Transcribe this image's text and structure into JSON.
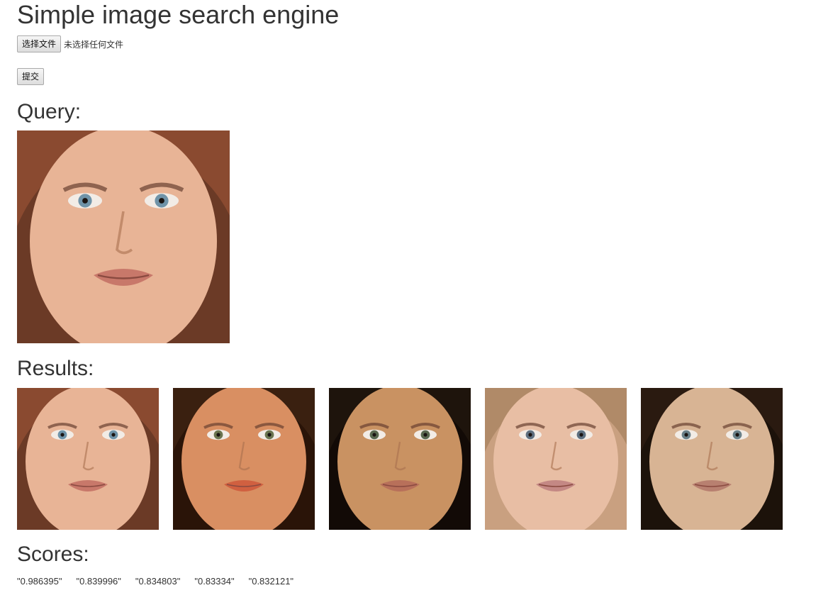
{
  "title": "Simple image search engine",
  "form": {
    "choose_file_label": "选择文件",
    "file_status": "未选择任何文件",
    "submit_label": "提交"
  },
  "query": {
    "heading": "Query:"
  },
  "results": {
    "heading": "Results:"
  },
  "scores": {
    "heading": "Scores:",
    "values": [
      "\"0.986395\"",
      "\"0.839996\"",
      "\"0.834803\"",
      "\"0.83334\"",
      "\"0.832121\""
    ]
  },
  "faces": {
    "query": {
      "skin": "#e8b496",
      "hair": "#8a4a30",
      "bg": "#6b3a26",
      "eyes": "#6f93a8",
      "lips": "#c8786a"
    },
    "result_0": {
      "skin": "#e8b496",
      "hair": "#8a4a30",
      "bg": "#6b3a26",
      "eyes": "#6f93a8",
      "lips": "#c8786a"
    },
    "result_1": {
      "skin": "#d98f62",
      "hair": "#3a2010",
      "bg": "#2a1408",
      "eyes": "#6b7550",
      "lips": "#d06040"
    },
    "result_2": {
      "skin": "#c99262",
      "hair": "#1e140c",
      "bg": "#120a06",
      "eyes": "#5a6850",
      "lips": "#b8705a"
    },
    "result_3": {
      "skin": "#e8bea4",
      "hair": "#b08a68",
      "bg": "#c9a080",
      "eyes": "#5e7080",
      "lips": "#c48884"
    },
    "result_4": {
      "skin": "#d8b494",
      "hair": "#2a1a10",
      "bg": "#1c120a",
      "eyes": "#6a8088",
      "lips": "#b88070"
    }
  }
}
